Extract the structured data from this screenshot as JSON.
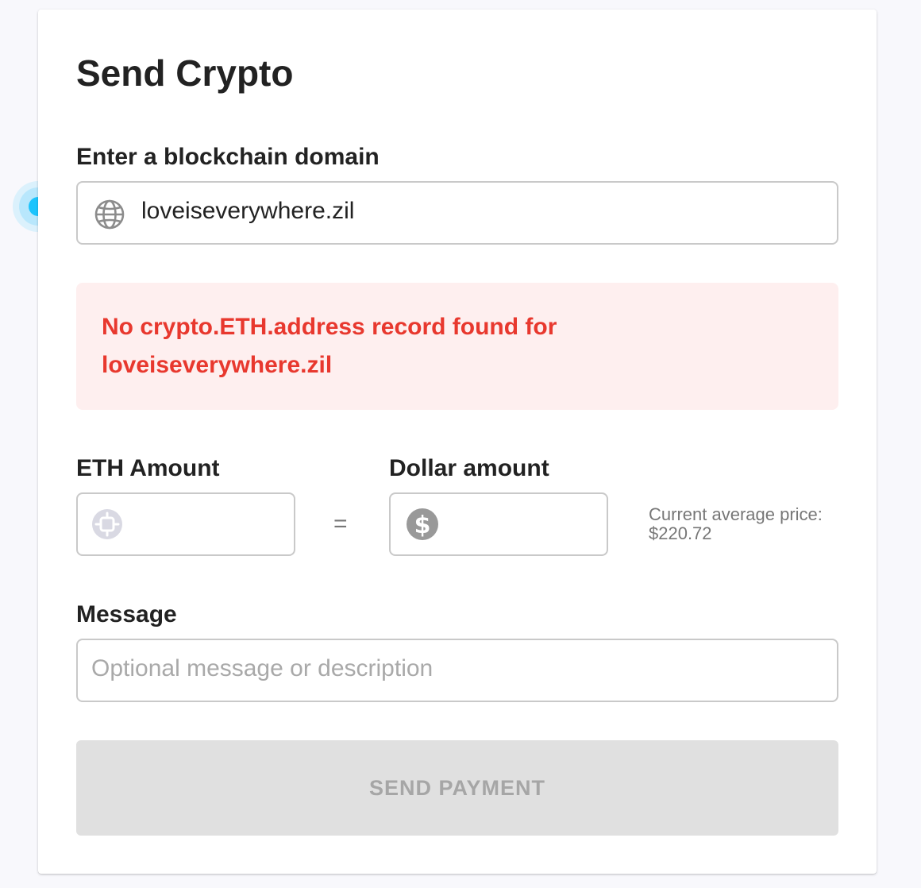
{
  "form": {
    "title": "Send Crypto",
    "domain_label": "Enter a blockchain domain",
    "domain_value": "loveiseverywhere.zil",
    "domain_icon": "globe-icon",
    "error_line1": "No crypto.ETH.address record found for",
    "error_line2": "loveiseverywhere.zil",
    "eth_label": "ETH Amount",
    "eth_icon": "eth-coin-icon",
    "dollar_label": "Dollar amount",
    "dollar_icon": "dollar-icon",
    "equals": "=",
    "price_label": "Current average price:",
    "price_value": "$220.72",
    "message_label": "Message",
    "message_placeholder": "Optional message or description",
    "send_label": "SEND PAYMENT"
  },
  "colors": {
    "error_text": "#e8382e",
    "error_background": "#feefef",
    "disabled_button": "#e0e0e0",
    "focus_indicator": "#1cc4fd"
  }
}
